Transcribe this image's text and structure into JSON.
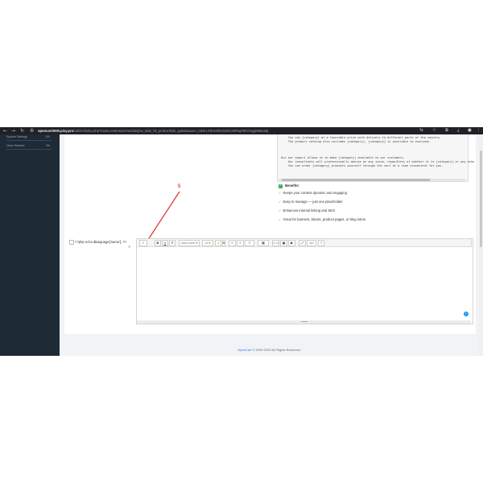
{
  "browser": {
    "url_domain": "opencart3000.pisy.pro",
    "url_path": "/admin/index.php?route=extension/module/jew_tabs_hit_product/tab_update&user_token=RE2v8D1s2NCs9Rsqr9IKO2ggMMaIa8j",
    "nav_icons": [
      "back-icon",
      "forward-icon",
      "reload-icon",
      "site-info-icon"
    ],
    "right_icons": [
      "translate-icon",
      "star-icon",
      "extensions-icon",
      "downloads-icon",
      "profile-icon",
      "menu-icon"
    ]
  },
  "sidebar": {
    "items": [
      {
        "label": "System Settings",
        "count": "0%"
      },
      {
        "label": "Other Statistic",
        "count": "0%"
      }
    ]
  },
  "preview": {
    "lines": [
      "     You can [category] at a favorable price with delivery to different parts of the country.",
      "     The product catalog also includes [category], [category] is available to everyone.",
      "",
      " Our our import allows us to make [category] available to our customers.",
      "     Our consultants will professionally advise on any issue, regardless of whether it is [category] or any othe",
      "     You can order [category] products yourself through the cart at a time convenient for you."
    ]
  },
  "benefits": {
    "title": "Benefits:",
    "items": [
      "Keeps your content dynamic and engaging",
      "Easy to manage — just one placeholder",
      "Enhances internal linking and SEO",
      "Great for banners, blocks, product pages, or blog intros"
    ]
  },
  "annotation": {
    "number": "5",
    "color": "#e53935"
  },
  "field": {
    "label": "<?php echo $language['name']; ?>",
    "suffix": ">"
  },
  "toolbar": {
    "magic_label": "✓",
    "bold_label": "B",
    "underline_label": "U",
    "clear_label": "✗",
    "font_family": "sans-serif",
    "font_size": "13",
    "color_label": "A",
    "ul_label": "≡",
    "ol_label": "≡",
    "para_label": "≡",
    "table_label": "▦",
    "link_label": "⊂⊃",
    "picture_label": "▣",
    "video_label": "▶",
    "fullscreen_label": "⤢",
    "code_label": "</>",
    "help_label": "?"
  },
  "footer": {
    "brand": "OpenCart",
    "text": " © 2009-2025 All Rights Reserved."
  }
}
